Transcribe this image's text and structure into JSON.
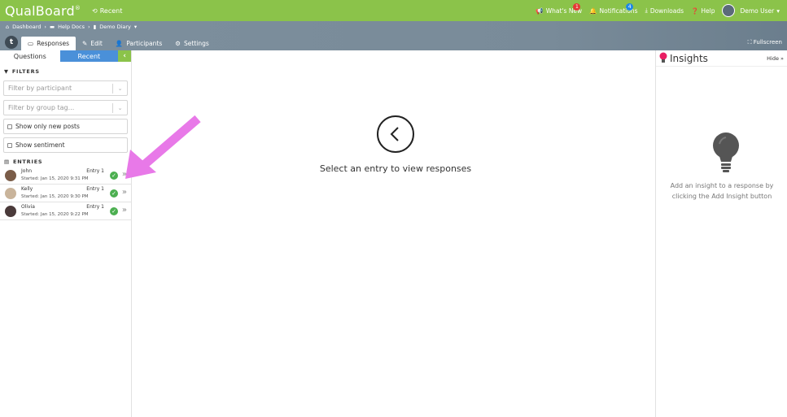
{
  "topbar": {
    "logo": "QualBoard",
    "logo_mark": "®",
    "recent_label": "Recent",
    "whats_new_label": "What's New",
    "whats_new_count": "1",
    "notifications_label": "Notifications",
    "notifications_count": "4",
    "downloads_label": "Downloads",
    "help_label": "Help",
    "user_label": "Demo User"
  },
  "breadcrumb": {
    "items": [
      "Dashboard",
      "Help Docs",
      "Demo Diary"
    ]
  },
  "tabs": {
    "logo_letter": "t",
    "items": [
      "Responses",
      "Edit",
      "Participants",
      "Settings"
    ],
    "fullscreen_label": "Fullscreen"
  },
  "sidebar": {
    "toggle_questions": "Questions",
    "toggle_recent": "Recent",
    "filters_header": "FILTERS",
    "participant_placeholder": "Filter by participant",
    "group_placeholder": "Filter by group tag...",
    "show_new_label": "Show only new posts",
    "show_sentiment_label": "Show sentiment",
    "entries_header": "ENTRIES",
    "entries": [
      {
        "name": "John",
        "entry": "Entry 1",
        "started": "Started: Jan 15, 2020 9:31 PM",
        "avatar_color": "#7a5c48"
      },
      {
        "name": "Kelly",
        "entry": "Entry 1",
        "started": "Started: Jan 15, 2020 9:30 PM",
        "avatar_color": "#c9b49b"
      },
      {
        "name": "Olivia",
        "entry": "Entry 1",
        "started": "Started: Jan 15, 2020 9:22 PM",
        "avatar_color": "#4a3a3a"
      }
    ]
  },
  "main": {
    "message": "Select an entry to view responses"
  },
  "insights": {
    "title": "Insights",
    "hide_label": "Hide",
    "message": "Add an insight to a response by clicking the Add Insight button"
  },
  "colors": {
    "brand_green": "#8bc34a",
    "accent_blue": "#4a90d9",
    "status_green": "#4caf50",
    "annotation_pink": "#e879e8",
    "insight_pink": "#e91e63"
  }
}
